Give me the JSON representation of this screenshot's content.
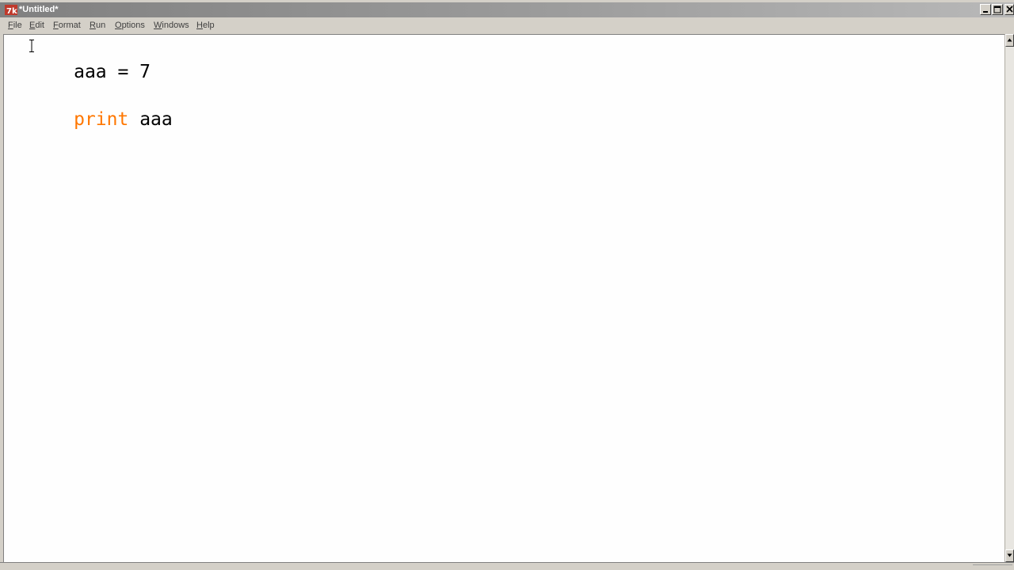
{
  "window": {
    "title": "*Untitled*"
  },
  "menu": {
    "items": [
      "File",
      "Edit",
      "Format",
      "Run",
      "Options",
      "Windows",
      "Help"
    ]
  },
  "editor": {
    "lines": [
      {
        "tokens": [
          {
            "text": "aaa = 7",
            "type": "plain"
          }
        ]
      },
      {
        "tokens": [
          {
            "text": "print",
            "type": "keyword"
          },
          {
            "text": " aaa",
            "type": "plain"
          }
        ]
      }
    ]
  },
  "colors": {
    "keyword": "#ff7700",
    "editor_bg": "#fefefe",
    "chrome": "#d4d0c8"
  }
}
